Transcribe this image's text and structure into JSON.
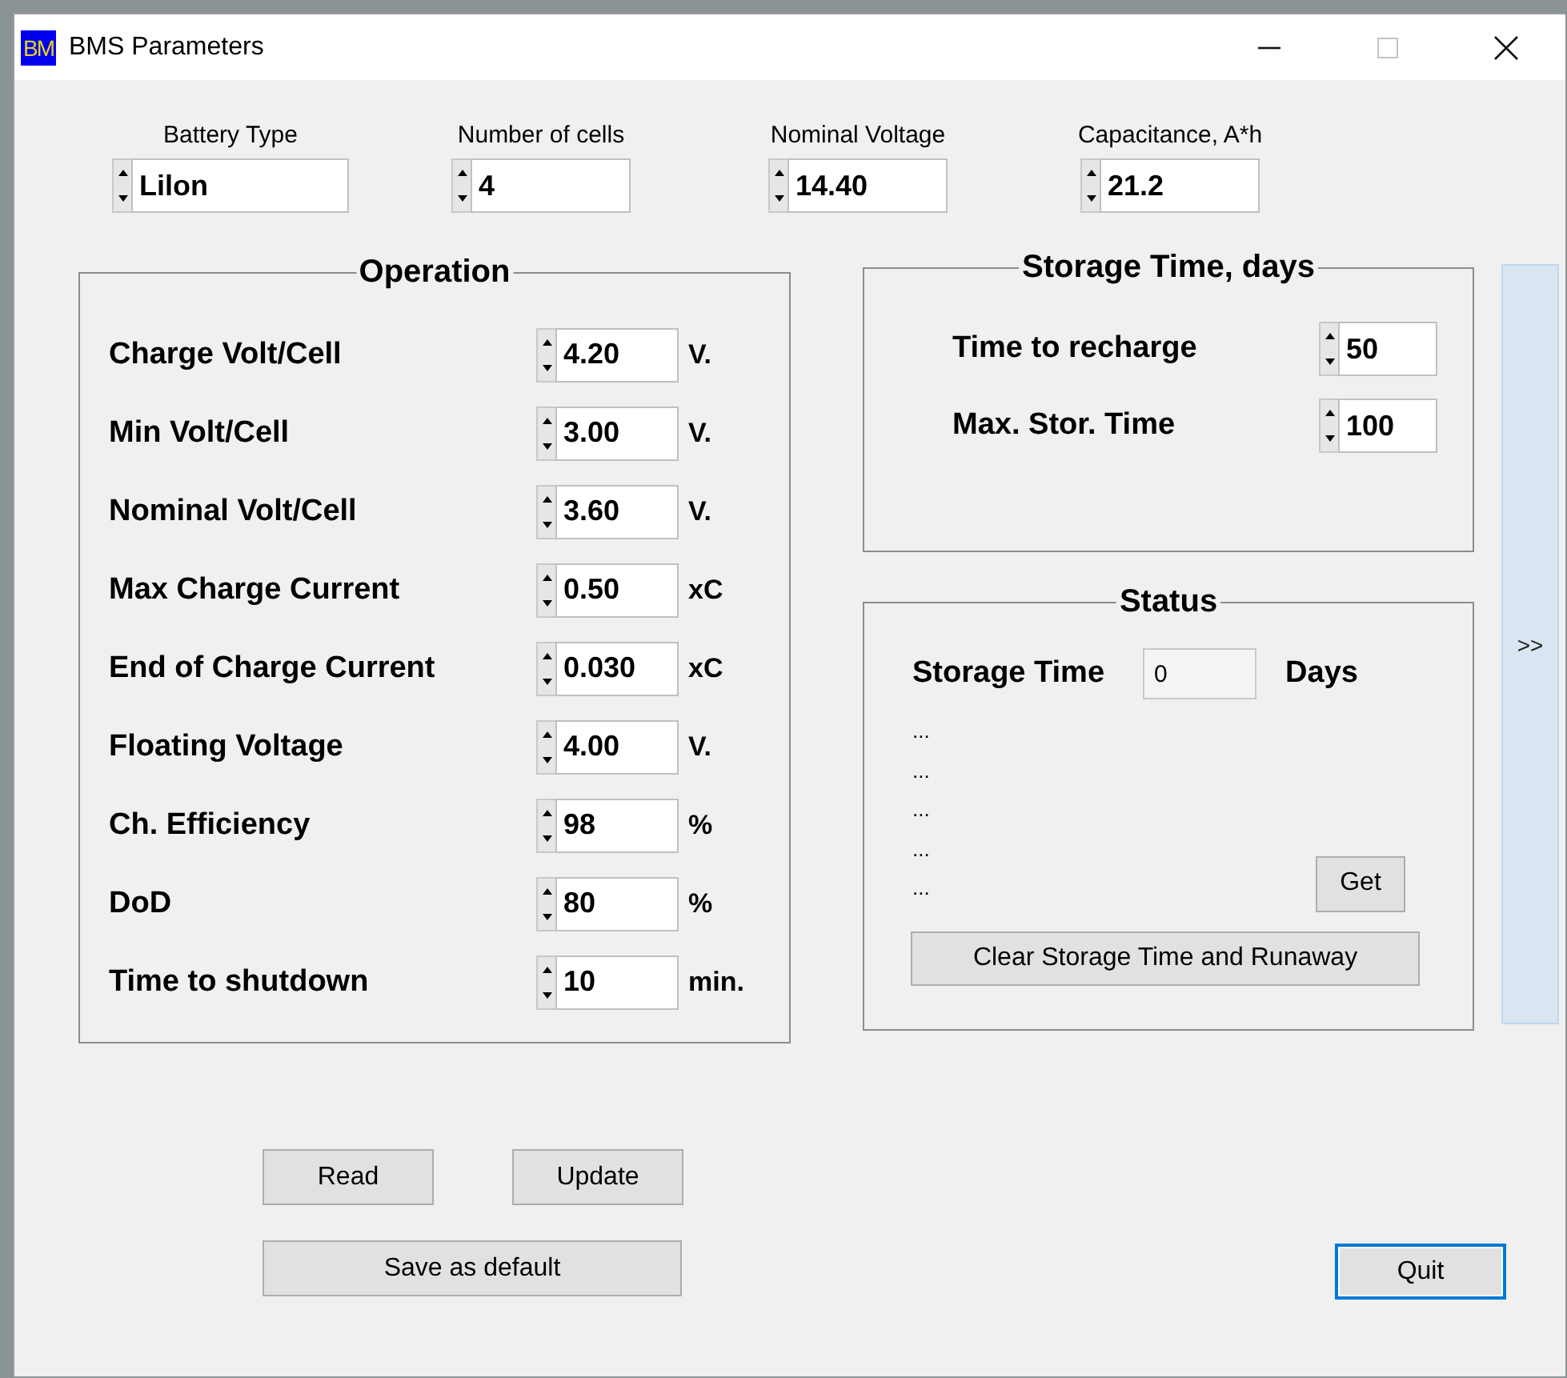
{
  "window": {
    "icon_text": "BM",
    "title": "BMS Parameters",
    "controls": [
      {
        "kind": "minimize",
        "disabled": false
      },
      {
        "kind": "maximize",
        "disabled": true
      },
      {
        "kind": "close",
        "disabled": false
      }
    ]
  },
  "top_fields": [
    {
      "label": "Battery Type",
      "value": "Lilon"
    },
    {
      "label": "Number of cells",
      "value": "4"
    },
    {
      "label": "Nominal Voltage",
      "value": "14.40"
    },
    {
      "label": "Capacitance, A*h",
      "value": "21.2"
    }
  ],
  "operation": {
    "title": "Operation",
    "rows": [
      {
        "label": "Charge Volt/Cell",
        "value": "4.20",
        "unit": "V."
      },
      {
        "label": "Min Volt/Cell",
        "value": "3.00",
        "unit": "V."
      },
      {
        "label": "Nominal Volt/Cell",
        "value": "3.60",
        "unit": "V."
      },
      {
        "label": "Max Charge Current",
        "value": "0.50",
        "unit": "xC"
      },
      {
        "label": "End of Charge Current",
        "value": "0.030",
        "unit": "xC"
      },
      {
        "label": "Floating Voltage",
        "value": "4.00",
        "unit": "V."
      },
      {
        "label": "Ch. Efficiency",
        "value": "98",
        "unit": "%"
      },
      {
        "label": "DoD",
        "value": "80",
        "unit": "%"
      },
      {
        "label": "Time to shutdown",
        "value": "10",
        "unit": "min."
      }
    ]
  },
  "storage_time": {
    "title": "Storage Time, days",
    "rows": [
      {
        "label": "Time to recharge",
        "value": "50"
      },
      {
        "label": "Max. Stor. Time",
        "value": "100"
      }
    ]
  },
  "status": {
    "title": "Status",
    "label": "Storage Time",
    "value": "0",
    "unit": "Days",
    "lines": [
      "...",
      "...",
      "...",
      "...",
      "..."
    ],
    "get_button": "Get",
    "clear_button": "Clear Storage Time and Runaway"
  },
  "side_button": ">>",
  "buttons": {
    "read": "Read",
    "update": "Update",
    "save": "Save as default",
    "quit": {
      "label": "Quit",
      "focused": true
    }
  }
}
